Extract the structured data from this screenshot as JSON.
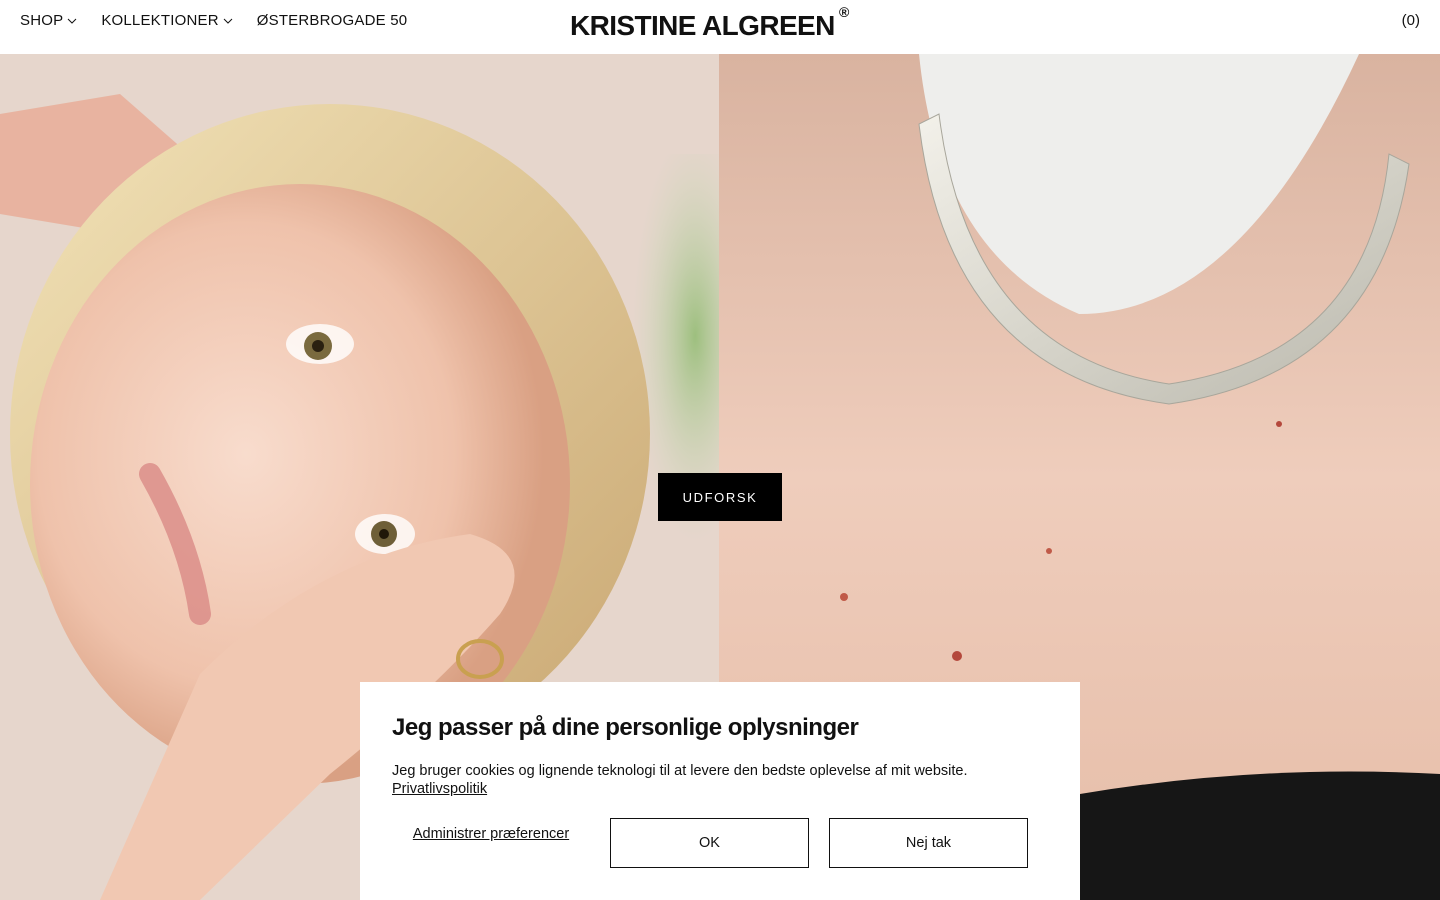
{
  "header": {
    "nav": [
      {
        "label": "SHOP",
        "has_dropdown": true
      },
      {
        "label": "KOLLEKTIONER",
        "has_dropdown": true
      },
      {
        "label": "ØSTERBROGADE 50",
        "has_dropdown": false
      }
    ],
    "logo": "KRISTINE ALGREEN",
    "logo_mark": "®",
    "cart": "(0)"
  },
  "hero": {
    "cta_label": "UDFORSK",
    "left_image_icon": "portrait-photo",
    "right_image_icon": "necklace-photo"
  },
  "cookie": {
    "title": "Jeg passer på dine personlige oplysninger",
    "text": "Jeg bruger cookies og lignende teknologi til at levere den bedste oplevelse af mit website.",
    "link": "Privatlivspolitik",
    "manage_label": "Administrer præferencer",
    "ok_label": "OK",
    "decline_label": "Nej tak"
  },
  "colors": {
    "text": "#111111",
    "cta_bg": "#000000",
    "background": "#ffffff"
  }
}
